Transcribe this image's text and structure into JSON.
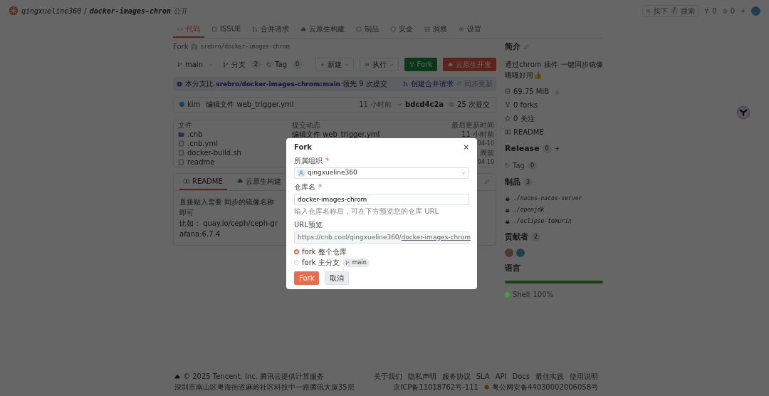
{
  "header": {
    "owner": "qingxueline360",
    "separator": "/",
    "repo": "docker-images-chron",
    "visibility": "公开",
    "search_key": "按下",
    "search_slash": "/",
    "search_label": "搜索",
    "forks": "0",
    "stars": "0"
  },
  "tabs": [
    {
      "label": "代码",
      "selected": true
    },
    {
      "label": "ISSUE",
      "selected": false
    },
    {
      "label": "合并请求",
      "selected": false
    },
    {
      "label": "云原生构建",
      "selected": false
    },
    {
      "label": "制品",
      "selected": false
    },
    {
      "label": "安全",
      "selected": false
    },
    {
      "label": "洞察",
      "selected": false
    },
    {
      "label": "设置",
      "selected": false
    }
  ],
  "fork_of": {
    "prefix": "Fork 自",
    "source": "srebro/docker-images-chrom"
  },
  "toolbar": {
    "branch": "main",
    "branches_label": "分支",
    "branches_count": "2",
    "tags_label": "Tag",
    "tags_count": "0",
    "new": "新建",
    "run": "执行",
    "fork": "Fork",
    "dev": "云原生开发"
  },
  "notice": {
    "text": "本分支比 **srebro/docker-images-chrom:main** 领先 9 次提交",
    "create_pr": "创建合并请求",
    "sync": "同步更新",
    "sync_disabled": true
  },
  "last_commit": {
    "author": "kim",
    "message": "编辑文件 web_trigger.yml",
    "time": "11 小时前",
    "sha": "bdcd4c2a",
    "commits": "25 次提交"
  },
  "files": {
    "columns": [
      "文件",
      "提交动态",
      "最后更新时间"
    ],
    "rows": [
      {
        "kind": "folder",
        "name": ".cnb",
        "commit": "编辑文件 web_trigger.yml",
        "updated": "11 小时前"
      },
      {
        "kind": "file",
        "name": ".cnb.yml",
        "updated": "04-10"
      },
      {
        "kind": "file",
        "name": "docker-build.sh",
        "updated": "周前"
      },
      {
        "kind": "file",
        "name": "readme",
        "updated": "04-10"
      }
    ]
  },
  "readme": {
    "tabs": [
      {
        "label": "README",
        "selected": true
      },
      {
        "label": "云原生构建",
        "selected": false
      }
    ],
    "lines": [
      "直接贴入需要 同步的镜像名称即可",
      "比如：  quay.io/ceph/ceph-grafana:6.7.4"
    ]
  },
  "sidebar": {
    "about_title": "简介",
    "description": [
      "通过chrom 插件 一键同步镜像",
      "嘎嘎好用👍"
    ],
    "stats": [
      {
        "kind": "size",
        "text": "69.75 MiB"
      },
      {
        "kind": "forks",
        "text": "0 forks"
      },
      {
        "kind": "stars",
        "text": "0 关注"
      },
      {
        "kind": "readme",
        "text": "README"
      }
    ],
    "release_title": "Release",
    "release_count": "0",
    "tag_label": "Tag",
    "tag_count": "0",
    "artifacts_title": "制品",
    "artifacts_count": "3",
    "artifacts": [
      "./nacos-nacos-server",
      "./openjdk",
      "./eclipse-temurin"
    ],
    "contributors_title": "贡献者",
    "contributors_count": "2",
    "languages_title": "语言",
    "languages": [
      {
        "name": "Shell",
        "percent": "100%",
        "level": 1,
        "color": "#3ea631"
      }
    ]
  },
  "footer": {
    "copyright": "© 2025 Tencent, Inc. 腾讯云提供计算服务",
    "address": "深圳市南山区粤海街道麻岭社区科技中一路腾讯大厦35层",
    "links": [
      "关于我们",
      "隐私声明",
      "服务协议",
      "SLA",
      "API",
      "Docs",
      "最佳实践",
      "使用说明"
    ],
    "icp": "京ICP备11018762号-111",
    "police": "粤公网安备44030002006058号"
  },
  "modal": {
    "title": "Fork",
    "close": "×",
    "required_mark": "*",
    "org_label": "所属组织",
    "org_value": "qingxueline360",
    "name_label": "仓库名",
    "name_value": "docker-images-chrom",
    "name_help": "输入仓库名称后，可在下方预览您的仓库 URL",
    "preview_label": "URL预览",
    "preview_prefix": "https://cnb.cool/qingxueline360/",
    "preview_repo": "docker-images-chrom",
    "options": [
      {
        "label": "fork 整个仓库",
        "selected": true
      },
      {
        "label": "fork 主分支",
        "branch": "main",
        "selected": false
      }
    ],
    "submit": "Fork",
    "cancel": "取消"
  }
}
